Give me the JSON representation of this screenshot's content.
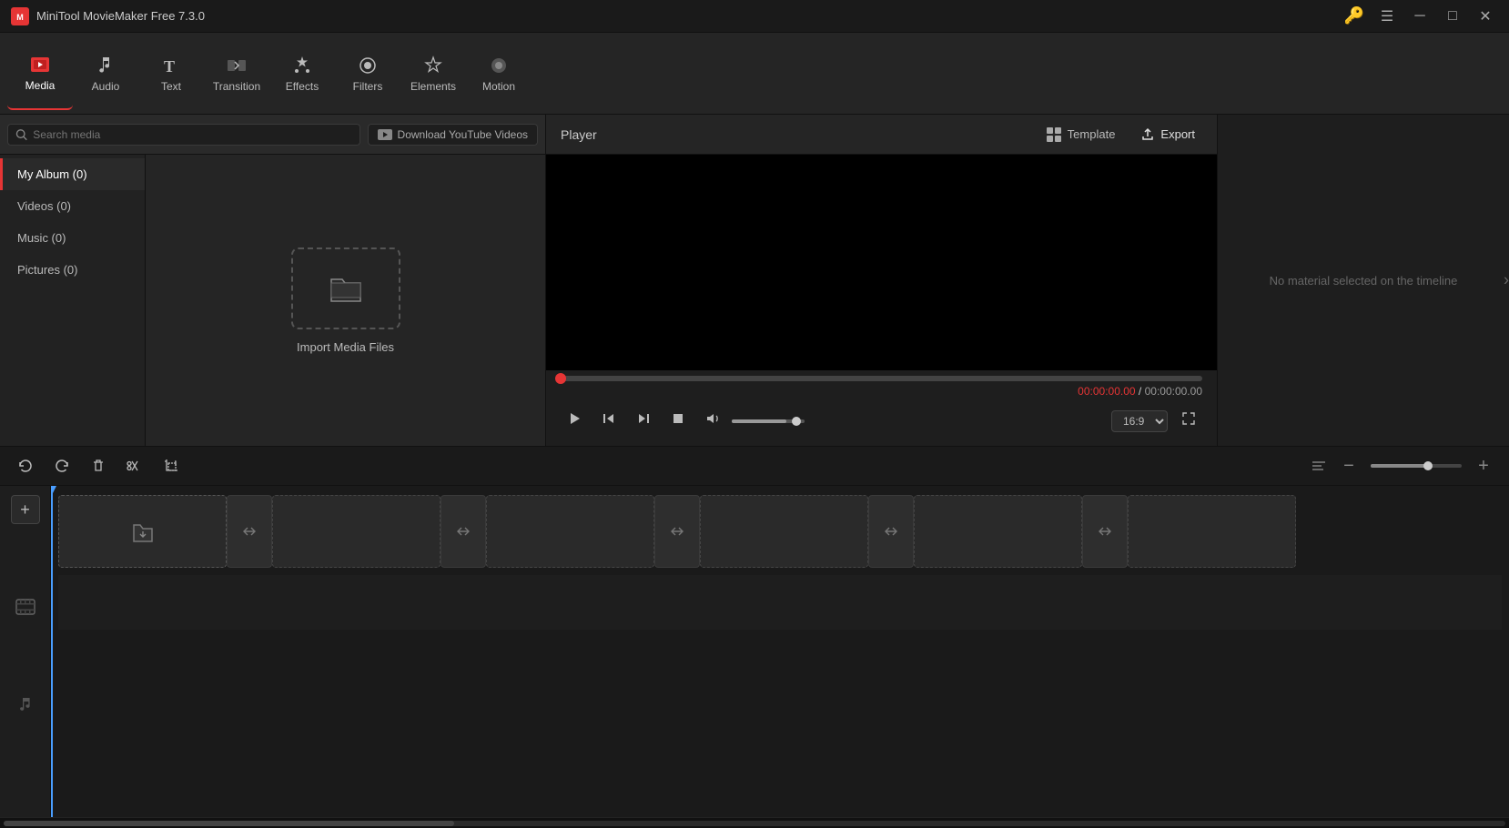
{
  "app": {
    "title": "MiniTool MovieMaker Free 7.3.0",
    "logo_text": "M"
  },
  "titlebar": {
    "key_icon": "🔑",
    "menu_icon": "☰",
    "minimize_icon": "─",
    "maximize_icon": "□",
    "close_icon": "✕"
  },
  "toolbar": {
    "items": [
      {
        "id": "media",
        "label": "Media",
        "icon": "🎬",
        "active": true
      },
      {
        "id": "audio",
        "label": "Audio",
        "icon": "♪"
      },
      {
        "id": "text",
        "label": "Text",
        "icon": "T"
      },
      {
        "id": "transition",
        "label": "Transition",
        "icon": "⇄"
      },
      {
        "id": "effects",
        "label": "Effects",
        "icon": "✦"
      },
      {
        "id": "filters",
        "label": "Filters",
        "icon": "◎"
      },
      {
        "id": "elements",
        "label": "Elements",
        "icon": "✦"
      },
      {
        "id": "motion",
        "label": "Motion",
        "icon": "●"
      }
    ]
  },
  "media_toolbar": {
    "search_placeholder": "Search media",
    "yt_button_label": "Download YouTube Videos"
  },
  "sidebar": {
    "items": [
      {
        "id": "my-album",
        "label": "My Album (0)",
        "active": true
      },
      {
        "id": "videos",
        "label": "Videos (0)"
      },
      {
        "id": "music",
        "label": "Music (0)"
      },
      {
        "id": "pictures",
        "label": "Pictures (0)"
      }
    ]
  },
  "import": {
    "icon": "📁",
    "label": "Import Media Files"
  },
  "player": {
    "title": "Player",
    "template_label": "Template",
    "export_label": "Export",
    "time_current": "00:00:00.00",
    "time_separator": " / ",
    "time_total": "00:00:00.00",
    "aspect_ratio": "16:9"
  },
  "right_panel": {
    "no_material_text": "No material selected on the timeline"
  },
  "timeline_controls": {
    "undo_icon": "↩",
    "redo_icon": "↪",
    "delete_icon": "🗑",
    "cut_icon": "✂",
    "crop_icon": "⌗",
    "zoom_minus": "−",
    "zoom_plus": "+"
  },
  "timeline": {
    "add_icon": "＋",
    "video_track_icon": "🎞",
    "audio_track_icon": "♫"
  }
}
